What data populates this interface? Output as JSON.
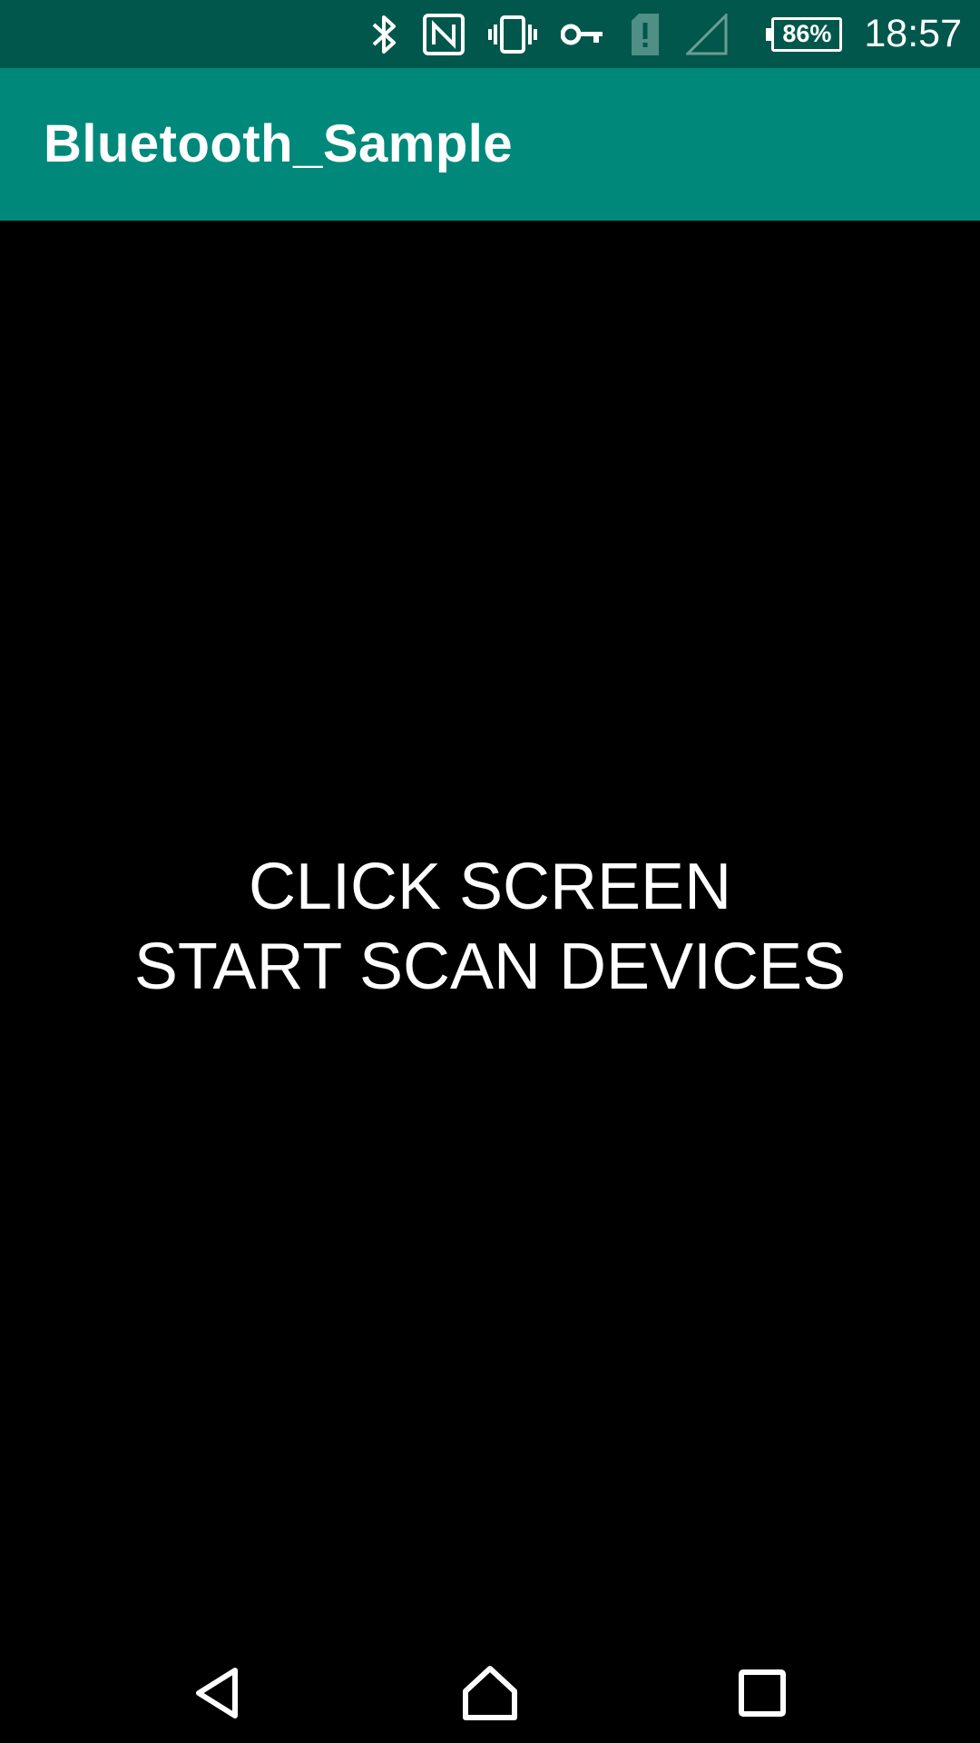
{
  "status_bar": {
    "time": "18:57",
    "battery_percent": "86%",
    "icons": [
      "bluetooth-icon",
      "nfc-icon",
      "vibrate-icon",
      "vpn-key-icon",
      "sim-alert-icon",
      "signal-icon"
    ]
  },
  "app_bar": {
    "title": "Bluetooth_Sample"
  },
  "main": {
    "prompt_line1": "CLICK SCREEN",
    "prompt_line2": "START SCAN DEVICES"
  },
  "nav_bar": {
    "buttons": [
      "back",
      "home",
      "recents"
    ]
  },
  "colors": {
    "status_bar": "#01574c",
    "app_bar": "#00897b",
    "background": "#000000",
    "text": "#ffffff"
  }
}
